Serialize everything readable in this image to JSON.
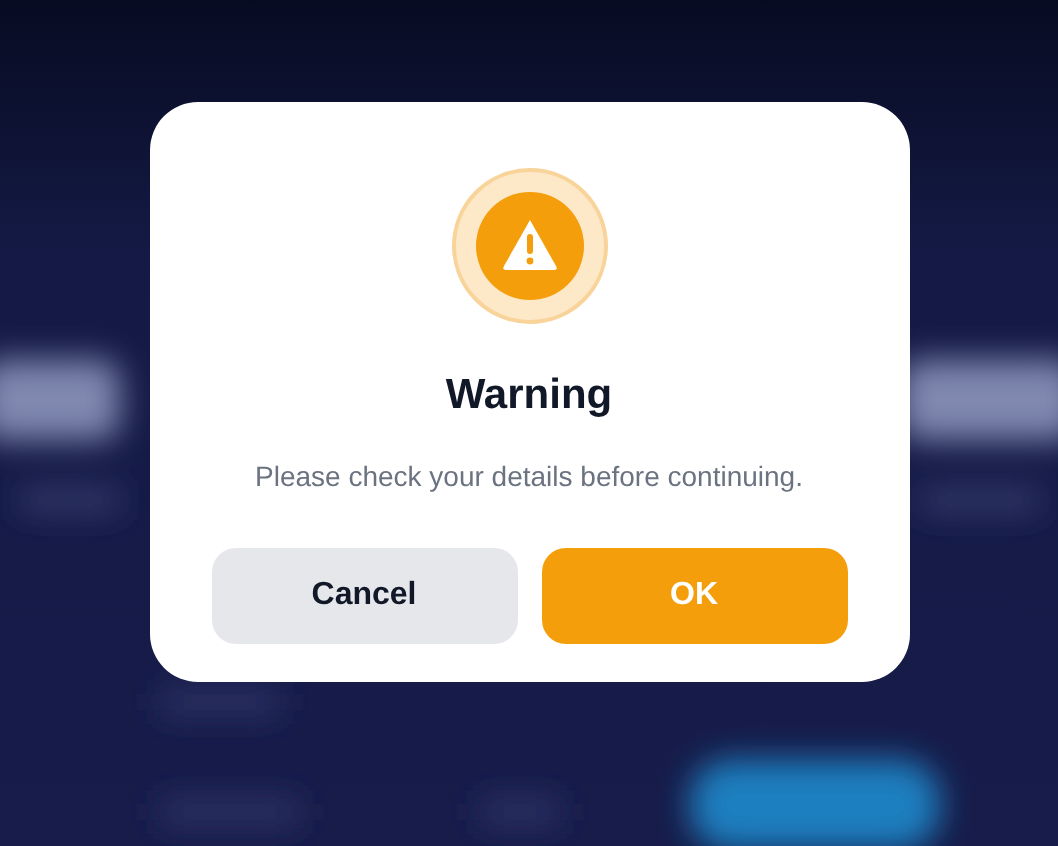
{
  "dialog": {
    "title": "Warning",
    "message": "Please check your details before continuing.",
    "buttons": [
      {
        "label": "Cancel",
        "kind": "secondary"
      },
      {
        "label": "OK",
        "kind": "primary"
      }
    ]
  }
}
